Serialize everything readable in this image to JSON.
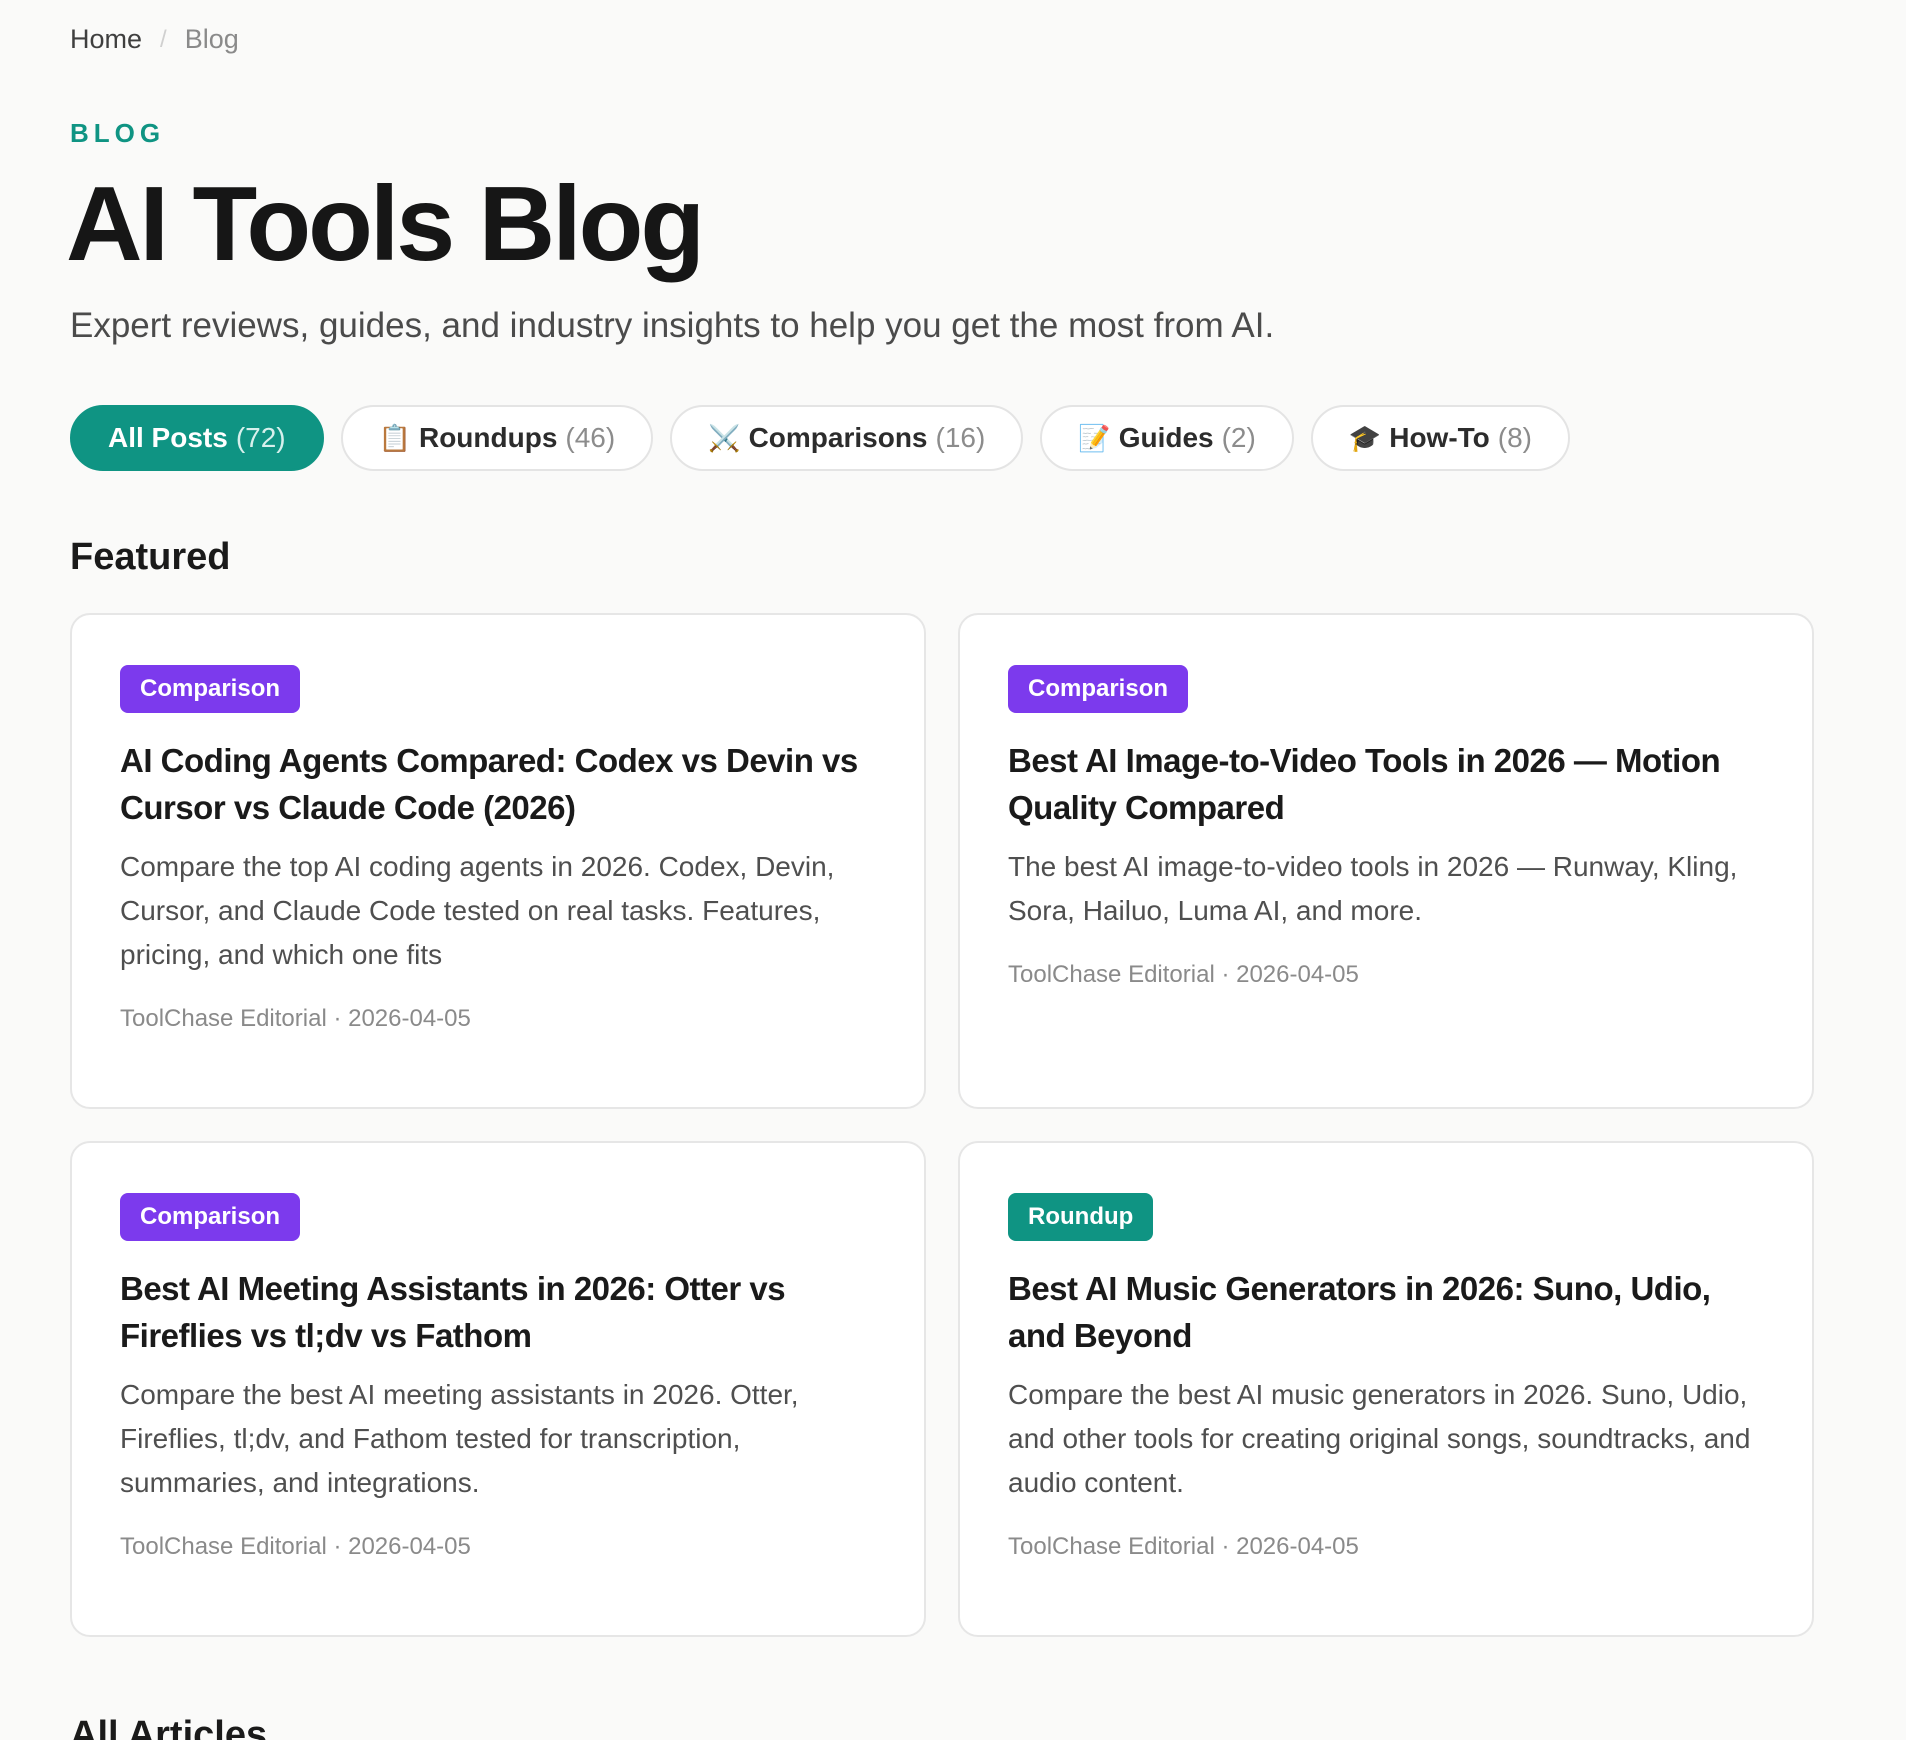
{
  "breadcrumb": {
    "home": "Home",
    "separator": "/",
    "current": "Blog"
  },
  "header": {
    "eyebrow": "BLOG",
    "title": "AI Tools Blog",
    "subtitle": "Expert reviews, guides, and industry insights to help you get the most from AI."
  },
  "filters": [
    {
      "emoji": "",
      "label": "All Posts",
      "count": "(72)",
      "active": true
    },
    {
      "emoji": "📋",
      "label": "Roundups",
      "count": "(46)",
      "active": false
    },
    {
      "emoji": "⚔️",
      "label": "Comparisons",
      "count": "(16)",
      "active": false
    },
    {
      "emoji": "📝",
      "label": "Guides",
      "count": "(2)",
      "active": false
    },
    {
      "emoji": "🎓",
      "label": "How-To",
      "count": "(8)",
      "active": false
    }
  ],
  "featured": {
    "heading": "Featured",
    "cards": [
      {
        "badge": "Comparison",
        "title": "AI Coding Agents Compared: Codex vs Devin vs Cursor vs Claude Code (2026)",
        "description": "Compare the top AI coding agents in 2026. Codex, Devin, Cursor, and Claude Code tested on real tasks. Features, pricing, and which one fits",
        "meta": "ToolChase Editorial · 2026-04-05"
      },
      {
        "badge": "Comparison",
        "title": "Best AI Image-to-Video Tools in 2026 — Motion Quality Compared",
        "description": "The best AI image-to-video tools in 2026 — Runway, Kling, Sora, Hailuo, Luma AI, and more.",
        "meta": "ToolChase Editorial · 2026-04-05"
      },
      {
        "badge": "Comparison",
        "title": "Best AI Meeting Assistants in 2026: Otter vs Fireflies vs tl;dv vs Fathom",
        "description": "Compare the best AI meeting assistants in 2026. Otter, Fireflies, tl;dv, and Fathom tested for transcription, summaries, and integrations.",
        "meta": "ToolChase Editorial · 2026-04-05"
      },
      {
        "badge": "Roundup",
        "title": "Best AI Music Generators in 2026: Suno, Udio, and Beyond",
        "description": "Compare the best AI music generators in 2026. Suno, Udio, and other tools for creating original songs, soundtracks, and audio content.",
        "meta": "ToolChase Editorial · 2026-04-05"
      }
    ]
  },
  "all_articles": {
    "heading": "All Articles"
  },
  "colors": {
    "accent": "#0f9483",
    "comparison_badge": "#7c3aed",
    "roundup_badge": "#0f9483"
  }
}
